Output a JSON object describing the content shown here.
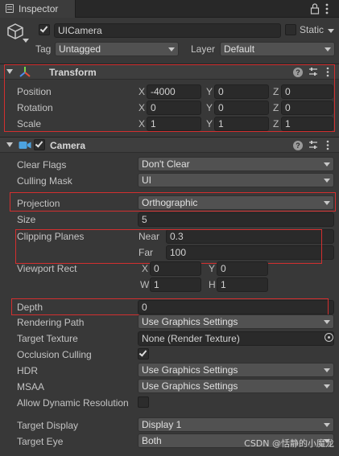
{
  "window": {
    "tab_label": "Inspector"
  },
  "object": {
    "name": "UICamera",
    "active": true,
    "static_label": "Static",
    "tag_label": "Tag",
    "tag_value": "Untagged",
    "layer_label": "Layer",
    "layer_value": "Default"
  },
  "transform": {
    "title": "Transform",
    "position": {
      "label": "Position",
      "x": "-4000",
      "y": "0",
      "z": "0"
    },
    "rotation": {
      "label": "Rotation",
      "x": "0",
      "y": "0",
      "z": "0"
    },
    "scale": {
      "label": "Scale",
      "x": "1",
      "y": "1",
      "z": "1"
    },
    "axis_x": "X",
    "axis_y": "Y",
    "axis_z": "Z"
  },
  "camera": {
    "title": "Camera",
    "enabled": true,
    "clear_flags": {
      "label": "Clear Flags",
      "value": "Don't Clear"
    },
    "culling_mask": {
      "label": "Culling Mask",
      "value": "UI"
    },
    "projection": {
      "label": "Projection",
      "value": "Orthographic"
    },
    "size": {
      "label": "Size",
      "value": "5"
    },
    "clipping_planes": {
      "label": "Clipping Planes",
      "near_label": "Near",
      "near": "0.3",
      "far_label": "Far",
      "far": "100"
    },
    "viewport_rect": {
      "label": "Viewport Rect",
      "x_label": "X",
      "x": "0",
      "y_label": "Y",
      "y": "0",
      "w_label": "W",
      "w": "1",
      "h_label": "H",
      "h": "1"
    },
    "depth": {
      "label": "Depth",
      "value": "0"
    },
    "rendering_path": {
      "label": "Rendering Path",
      "value": "Use Graphics Settings"
    },
    "target_texture": {
      "label": "Target Texture",
      "value": "None (Render Texture)"
    },
    "occlusion_culling": {
      "label": "Occlusion Culling",
      "checked": true
    },
    "hdr": {
      "label": "HDR",
      "value": "Use Graphics Settings"
    },
    "msaa": {
      "label": "MSAA",
      "value": "Use Graphics Settings"
    },
    "dynamic_resolution": {
      "label": "Allow Dynamic Resolution",
      "checked": false
    },
    "target_display": {
      "label": "Target Display",
      "value": "Display 1"
    },
    "target_eye": {
      "label": "Target Eye",
      "value": "Both"
    }
  },
  "watermark": "CSDN @恬静的小魔龙",
  "colors": {
    "background": "#383838",
    "highlight_box": "#d32f2f"
  }
}
